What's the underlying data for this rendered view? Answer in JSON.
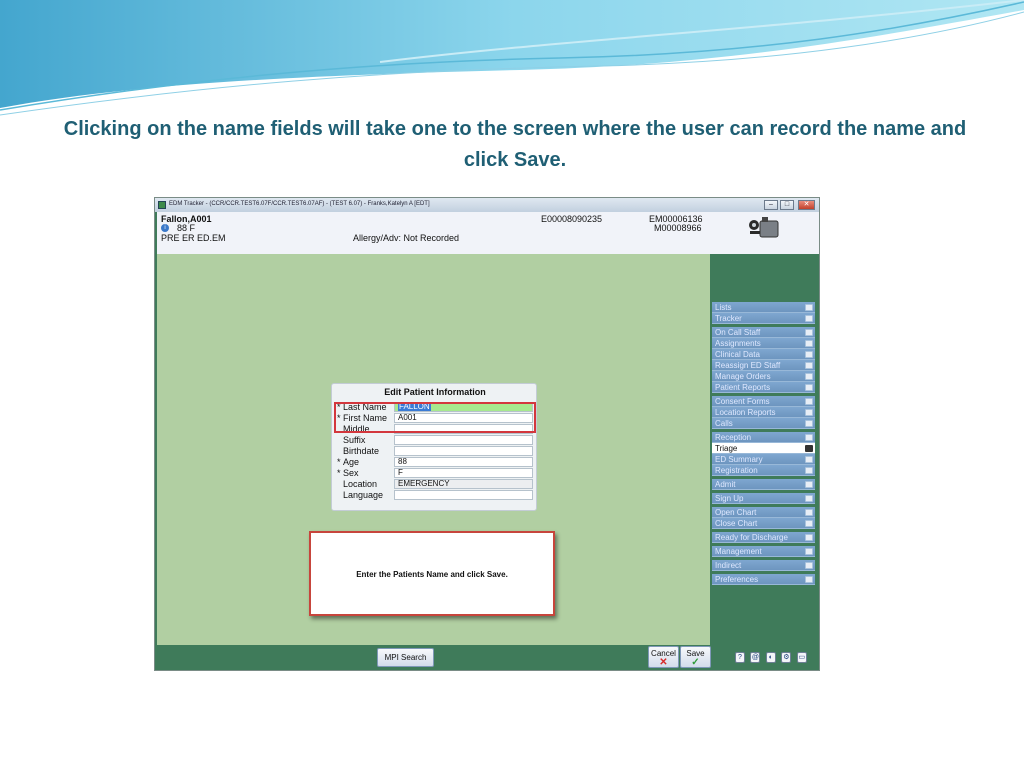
{
  "slide": {
    "title": "Clicking on the name fields will take one to the screen where the user can record the name and click Save."
  },
  "window": {
    "title": "EDM Tracker - (CCR/CCR.TEST6.07F/CCR.TEST6.07AF) - (TEST 6.07) - Franks,Katelyn A [EDT]",
    "buttons": [
      "–",
      "□",
      "✕"
    ]
  },
  "patient": {
    "name": "Fallon,A001",
    "age_sex": "88  F",
    "location": "PRE ER  ED.EM",
    "allergy": "Allergy/Adv: Not Recorded",
    "account_1": "E00008090235",
    "account_2": "EM00006136",
    "account_3": "M00008966"
  },
  "sidebar": {
    "groups": [
      [
        {
          "label": "Lists"
        },
        {
          "label": "Tracker"
        }
      ],
      [
        {
          "label": "On Call Staff"
        },
        {
          "label": "Assignments"
        },
        {
          "label": "Clinical Data"
        },
        {
          "label": "Reassign ED Staff"
        },
        {
          "label": "Manage Orders"
        },
        {
          "label": "Patient Reports"
        }
      ],
      [
        {
          "label": "Consent Forms"
        },
        {
          "label": "Location Reports"
        },
        {
          "label": "Calls"
        }
      ],
      [
        {
          "label": "Reception"
        },
        {
          "label": "Triage",
          "active": true
        },
        {
          "label": "ED Summary"
        },
        {
          "label": "Registration"
        }
      ],
      [
        {
          "label": "Admit"
        }
      ],
      [
        {
          "label": "Sign Up"
        }
      ],
      [
        {
          "label": "Open Chart"
        },
        {
          "label": "Close Chart"
        }
      ],
      [
        {
          "label": "Ready for Discharge"
        }
      ],
      [
        {
          "label": "Management"
        }
      ],
      [
        {
          "label": "Indirect"
        }
      ],
      [
        {
          "label": "Preferences"
        }
      ]
    ]
  },
  "form": {
    "title": "Edit Patient Information",
    "fields": [
      {
        "label": "Last Name",
        "required": true,
        "value": "FALLON",
        "selected": true
      },
      {
        "label": "First Name",
        "required": true,
        "value": "A001"
      },
      {
        "label": "Middle",
        "required": false,
        "value": ""
      },
      {
        "label": "Suffix",
        "required": false,
        "value": ""
      },
      {
        "label": "Birthdate",
        "required": false,
        "value": ""
      },
      {
        "label": "Age",
        "required": true,
        "value": "88"
      },
      {
        "label": "Sex",
        "required": true,
        "value": "F"
      },
      {
        "label": "Location",
        "required": false,
        "value": "EMERGENCY",
        "readonly": true
      },
      {
        "label": "Language",
        "required": false,
        "value": ""
      }
    ]
  },
  "callout": {
    "text": "Enter the Patients Name and click Save."
  },
  "toolbar": {
    "mpi_search": "MPI Search",
    "cancel": "Cancel",
    "save": "Save",
    "cancel_glyph": "✕",
    "save_glyph": "✓",
    "icons": [
      "?",
      "@",
      "◐",
      "⚙",
      "▭"
    ]
  },
  "colors": {
    "title": "#1f5f74",
    "app_green": "#3f7b5a",
    "content_green": "#b1cfa2",
    "sidebar_blue": "#7fa7d0",
    "highlight_red": "#d3373d"
  }
}
